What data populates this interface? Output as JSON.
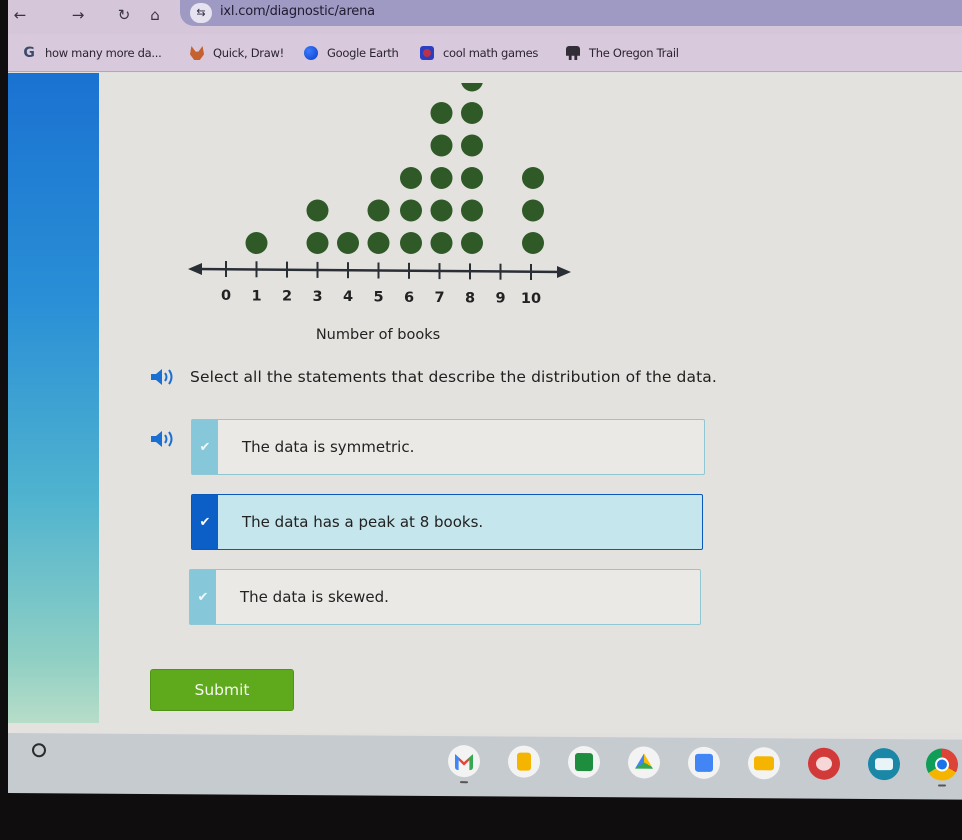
{
  "browser": {
    "nav": {
      "back_icon": "←",
      "forward_icon": "→",
      "reload_icon": "↻",
      "home_icon": "⌂"
    },
    "address_bar": {
      "site_settings_icon": "⇆",
      "url": "ixl.com/diagnostic/arena"
    },
    "bookmarks": [
      {
        "label": "how many more da...",
        "icon": "google-g-icon"
      },
      {
        "label": "Quick, Draw!",
        "icon": "quick-draw-icon"
      },
      {
        "label": "Google Earth",
        "icon": "google-earth-icon"
      },
      {
        "label": "cool math games",
        "icon": "coolmath-icon"
      },
      {
        "label": "The Oregon Trail",
        "icon": "oregon-trail-icon"
      }
    ],
    "google_g": "G"
  },
  "colors": {
    "dot": "#2f5a27",
    "axis": "#2a2f36",
    "selected_strip": "#0b5fc6",
    "hover_strip": "#86c8da",
    "submit": "#5faa1c"
  },
  "chart_data": {
    "type": "scatter",
    "subtype": "dot-plot",
    "title": "",
    "xlabel": "Number of books",
    "ylabel": "",
    "x_ticks": [
      0,
      1,
      2,
      3,
      4,
      5,
      6,
      7,
      8,
      9,
      10
    ],
    "xlim": [
      0,
      10
    ],
    "counts": {
      "0": 0,
      "1": 1,
      "2": 0,
      "3": 2,
      "4": 1,
      "5": 2,
      "6": 3,
      "7": 5,
      "8": 6,
      "9": 0,
      "10": 3
    },
    "notes": "Topmost dot at 8 is partially cut off by the viewport.",
    "grid": false
  },
  "question": {
    "prompt": "Select all the statements that describe the distribution of the data.",
    "options": [
      {
        "label": "The data is symmetric.",
        "selected": false,
        "state": "hover"
      },
      {
        "label": "The data has a peak at 8 books.",
        "selected": true,
        "state": "selected"
      },
      {
        "label": "The data is skewed.",
        "selected": false,
        "state": "default"
      }
    ],
    "check_glyph": "✔",
    "submit_label": "Submit"
  },
  "shelf": {
    "apps": [
      {
        "name": "Gmail",
        "running": true
      },
      {
        "name": "Google Keep",
        "running": false
      },
      {
        "name": "Google Classroom",
        "running": false
      },
      {
        "name": "Google Drive",
        "running": false
      },
      {
        "name": "Google Docs",
        "running": false
      },
      {
        "name": "Google Slides",
        "running": false
      },
      {
        "name": "Canvas",
        "running": false
      },
      {
        "name": "Screencast",
        "running": false
      },
      {
        "name": "Google Chrome",
        "running": true
      }
    ]
  }
}
